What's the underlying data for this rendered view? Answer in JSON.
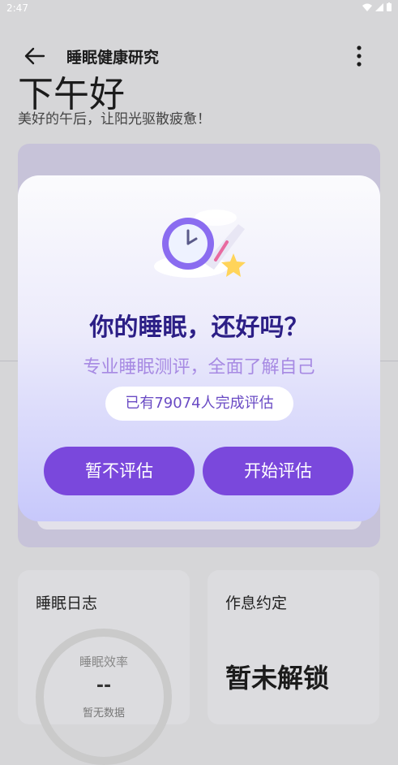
{
  "status_bar": {
    "time": "2:47"
  },
  "app_bar": {
    "title": "睡眠健康研究"
  },
  "home": {
    "greeting": "下午好",
    "subtitle": "美好的午后，让阳光驱散疲惫！"
  },
  "cards": {
    "sleep_log": {
      "title": "睡眠日志",
      "ring_label": "睡眠效率",
      "ring_value": "--",
      "ring_sub": "暂无数据"
    },
    "routine": {
      "title": "作息约定",
      "status": "暂未解锁"
    }
  },
  "dialog": {
    "title": "你的睡眠，还好吗？",
    "subtitle": "专业睡眠测评，全面了解自己",
    "count_text": "已有79074人完成评估",
    "skip_label": "暂不评估",
    "start_label": "开始评估",
    "illustration_icon": "clock-with-star-icon"
  },
  "colors": {
    "accent": "#7a48dc",
    "title_text": "#2c1f86",
    "subtitle_text": "#a78ae3"
  }
}
